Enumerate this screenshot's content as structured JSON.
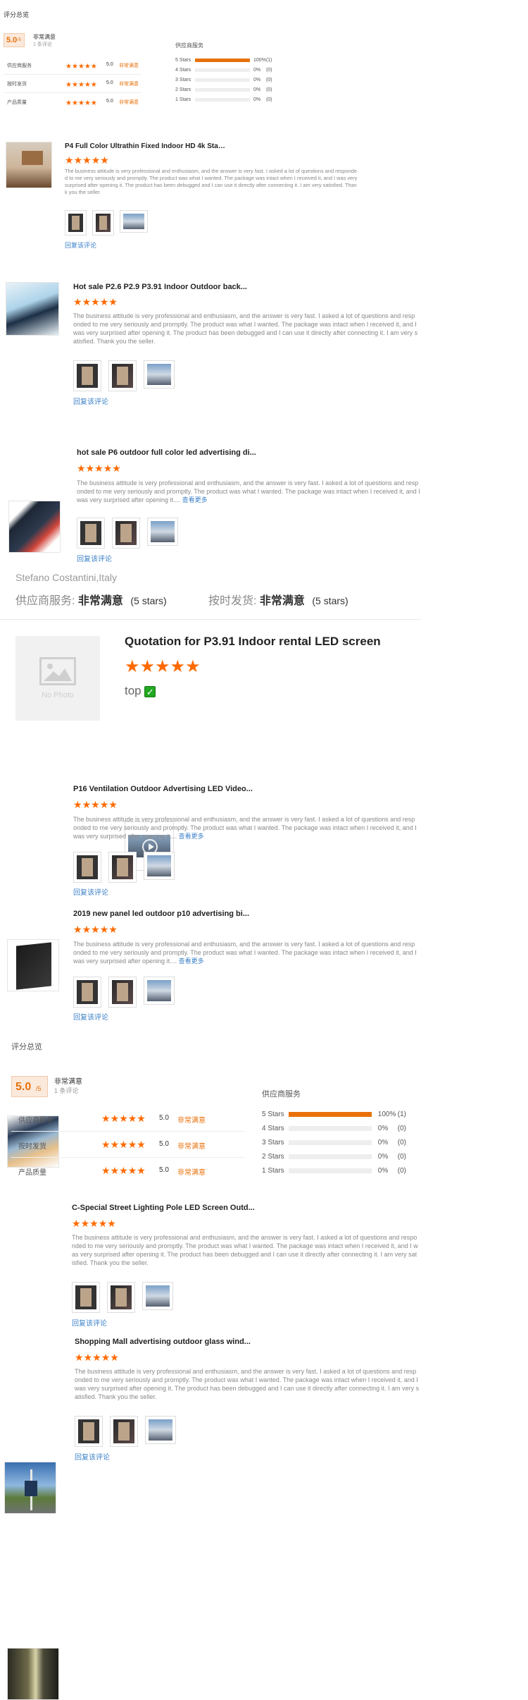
{
  "summary": {
    "title": "评分总览",
    "score": "5.0",
    "score_suffix": "/5",
    "overall_label": "非常满意",
    "review_count": "1 条评论",
    "rows": [
      {
        "label": "供应商服务",
        "value": "5.0",
        "verdict": "非常满意",
        "stars": 5
      },
      {
        "label": "按时发货",
        "value": "5.0",
        "verdict": "非常满意",
        "stars": 5
      },
      {
        "label": "产品质量",
        "value": "5.0",
        "verdict": "非常满意",
        "stars": 5
      }
    ],
    "dist_title": "供应商服务",
    "distribution": [
      {
        "label": "5 Stars",
        "percent": "100%",
        "count": "(1)",
        "fraction": 1.0
      },
      {
        "label": "4 Stars",
        "percent": "0%",
        "count": "(0)",
        "fraction": 0
      },
      {
        "label": "3 Stars",
        "percent": "0%",
        "count": "(0)",
        "fraction": 0
      },
      {
        "label": "2 Stars",
        "percent": "0%",
        "count": "(0)",
        "fraction": 0
      },
      {
        "label": "1 Stars",
        "percent": "0%",
        "count": "(0)",
        "fraction": 0
      }
    ]
  },
  "review_text": "The business attitude is very professional and enthusiasm, and the answer is very fast. I asked a lot of questions and responded to me very seriously and promptly. The product was what I wanted. The package was intact when I received it, and I was very surprised after opening it. The product has been debugged and I can use it directly after connecting it. I am very satisfied. Thank you the seller.",
  "review_text_short": "The business attitude is very professional and enthusiasm, and the answer is very fast. I asked a lot of questions and responded to me very seriously and promptly. The product was what I wanted. The package was intact when I received it, and I was very surprised after opening it....",
  "see_more": "查看更多",
  "reply_label": "回复该评论",
  "reviews": [
    {
      "title": "P4 Full Color Ultrathin Fixed Indoor HD 4k Stag..."
    },
    {
      "title": "Hot sale P2.6 P2.9 P3.91 Indoor Outdoor back..."
    },
    {
      "title": "hot sale P6 outdoor full color led advertising di..."
    },
    {
      "title": "P16 Ventilation Outdoor Advertising LED Video..."
    },
    {
      "title": "2019 new panel led outdoor p10 advertising bi..."
    },
    {
      "title": "C-Special Street Lighting Pole LED Screen Outd..."
    },
    {
      "title": "Shopping Mall advertising outdoor glass wind..."
    }
  ],
  "buyer": {
    "name": "Stefano Costantini,Italy",
    "service_label": "供应商服务:",
    "service_value": "非常满意",
    "service_stars": "(5 stars)",
    "ship_label": "按时发货:",
    "ship_value": "非常满意",
    "ship_stars": "(5 stars)"
  },
  "quote": {
    "title": "Quotation for P3.91 Indoor rental LED screen",
    "no_photo": "No Photo",
    "tag": "top",
    "check": "✓"
  },
  "icons": {
    "star": "★",
    "play": "play-icon"
  }
}
